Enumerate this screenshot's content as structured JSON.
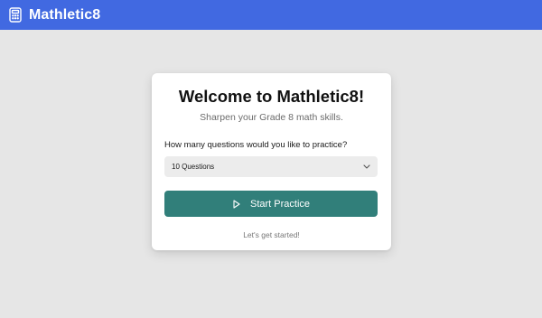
{
  "header": {
    "app_title": "Mathletic8",
    "logo_icon": "calculator-icon",
    "background_color": "#4169e1"
  },
  "card": {
    "title": "Welcome to Mathletic8!",
    "subtitle": "Sharpen your Grade 8 math skills.",
    "question_label": "How many questions would you like to practice?",
    "select": {
      "selected_value": "10 Questions",
      "icon": "chevron-down-icon"
    },
    "start_button": {
      "label": "Start Practice",
      "icon": "play-icon",
      "color": "#317f7a"
    },
    "footer_text": "Let's get started!"
  }
}
